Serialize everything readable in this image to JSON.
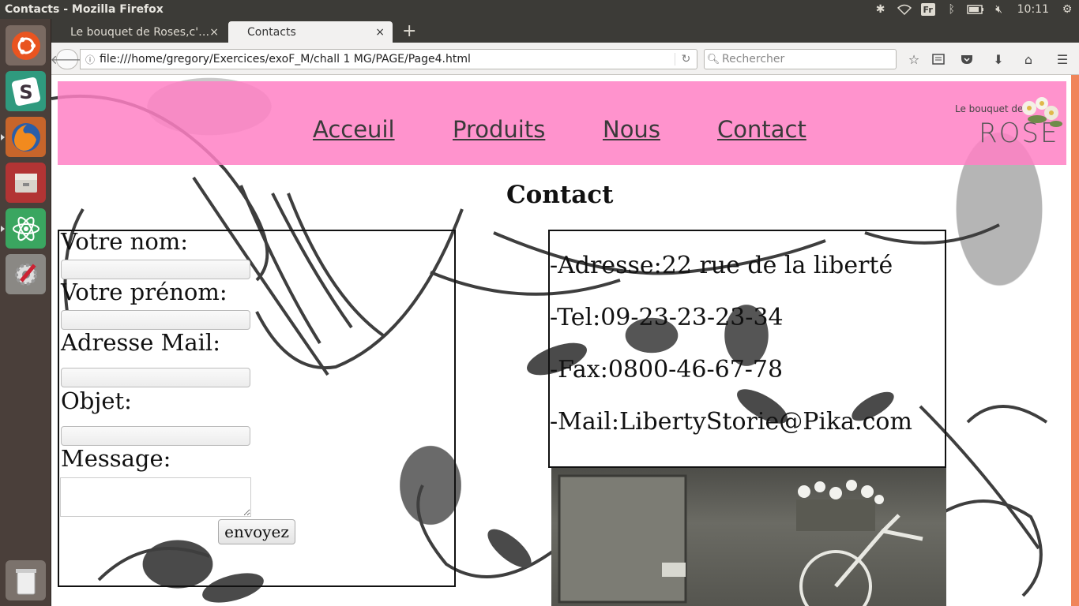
{
  "window": {
    "title": "Contacts - Mozilla Firefox"
  },
  "panel": {
    "keyboard_layout": "Fr",
    "clock": "10:11"
  },
  "browser": {
    "tabs": [
      {
        "label": "Le bouquet de Roses,c'…",
        "active": false
      },
      {
        "label": "Contacts",
        "active": true
      }
    ],
    "tab_close_glyph": "×",
    "new_tab_glyph": "+",
    "url": "file:///home/gregory/Exercices/exoF_M/chall 1 MG/PAGE/Page4.html",
    "search_placeholder": "Rechercher"
  },
  "site": {
    "nav": [
      "Acceuil",
      "Produits",
      "Nous",
      "Contact"
    ],
    "logo": {
      "small": "Le bouquet de",
      "big": "ROSE"
    },
    "heading": "Contact",
    "form": {
      "name_label": "Votre nom:",
      "firstname_label": "Votre prénom:",
      "email_label": "Adresse Mail:",
      "subject_label": "Objet:",
      "message_label": "Message:",
      "submit_label": "envoyez"
    },
    "info": {
      "address": "-Adresse:22 rue de la liberté",
      "tel": "-Tel:09-23-23-23-34",
      "fax": "-Fax:0800-46-67-78",
      "mail": "-Mail:LibertyStorie@Pika.com"
    }
  },
  "colors": {
    "header_pink": "#ff80c4",
    "scrollbar": "#f0855a"
  }
}
